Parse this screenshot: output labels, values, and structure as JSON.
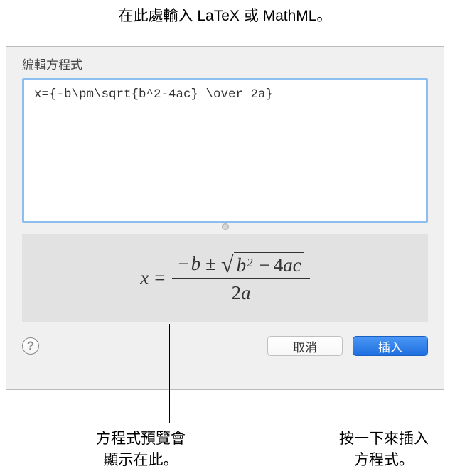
{
  "annotations": {
    "top": "在此處輸入 LaTeX 或 MathML。",
    "bottomLeft1": "方程式預覽會",
    "bottomLeft2": "顯示在此。",
    "bottomRight1": "按一下來插入",
    "bottomRight2": "方程式。"
  },
  "dialog": {
    "title": "編輯方程式",
    "input_value": "x={-b\\pm\\sqrt{b^2-4ac} \\over 2a}",
    "help_label": "?",
    "cancel_label": "取消",
    "insert_label": "插入"
  },
  "equation": {
    "x": "x",
    "equals": "=",
    "minus": "−",
    "b": "b",
    "plusminus": "±",
    "sqrt": "√",
    "b2": "b",
    "sup2": "2",
    "minus2": "−",
    "four": "4",
    "a": "a",
    "c": "c",
    "two": "2",
    "a2": "a"
  }
}
